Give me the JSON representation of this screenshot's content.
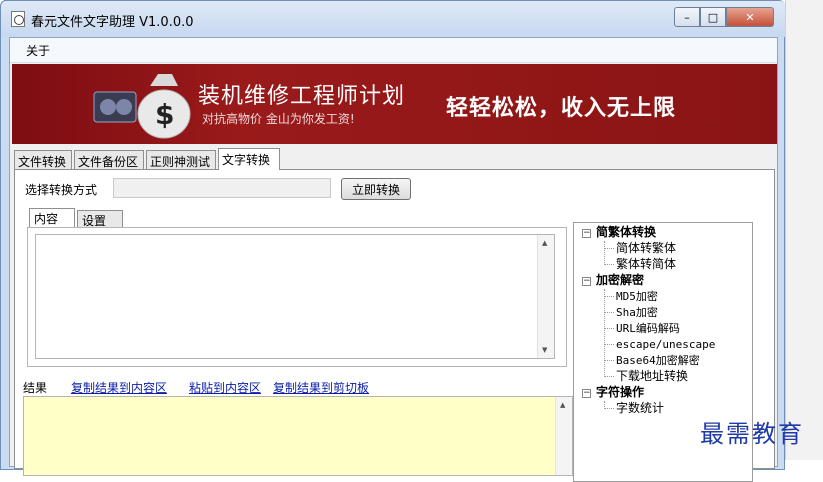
{
  "window": {
    "title": "春元文件文字助理 V1.0.0.0",
    "controls": {
      "minimize": "–",
      "maximize": "□",
      "close": "✕"
    }
  },
  "menu": {
    "items": [
      "关于"
    ]
  },
  "banner": {
    "headline": "装机维修工程师计划",
    "tagline": "对抗高物价 金山为你发工资!",
    "slogan": "轻轻松松，收入无上限",
    "icon": "money-bag-dollar-icon"
  },
  "tabs": [
    {
      "label": "文件转换",
      "active": false
    },
    {
      "label": "文件备份区",
      "active": false
    },
    {
      "label": "正则神测试",
      "active": false
    },
    {
      "label": "文字转换",
      "active": true
    }
  ],
  "convert": {
    "mode_label": "选择转换方式",
    "mode_value": "",
    "convert_button": "立即转换"
  },
  "subtabs": [
    {
      "label": "内容",
      "active": true
    },
    {
      "label": "设置",
      "active": false
    }
  ],
  "content": {
    "text": ""
  },
  "result": {
    "label": "结果",
    "copy_to_content": "复制结果到内容区",
    "paste_to_content": "粘贴到内容区",
    "copy_to_clipboard": "复制结果到剪切板",
    "text": ""
  },
  "tree": {
    "groups": [
      {
        "label": "简繁体转换",
        "expanded": true,
        "items": [
          "简体转繁体",
          "繁体转简体"
        ]
      },
      {
        "label": "加密解密",
        "expanded": true,
        "items": [
          "MD5加密",
          "Sha加密",
          "URL编码解码",
          "escape/unescape",
          "Base64加密解密",
          "下载地址转换"
        ]
      },
      {
        "label": "字符操作",
        "expanded": true,
        "items": [
          "字数统计"
        ]
      }
    ]
  },
  "watermark": "最需教育",
  "colors": {
    "banner_bg": "#8a1414",
    "result_bg": "#ffffc8",
    "link": "#0a1ea8",
    "titlebar": "#c7d8ef"
  }
}
